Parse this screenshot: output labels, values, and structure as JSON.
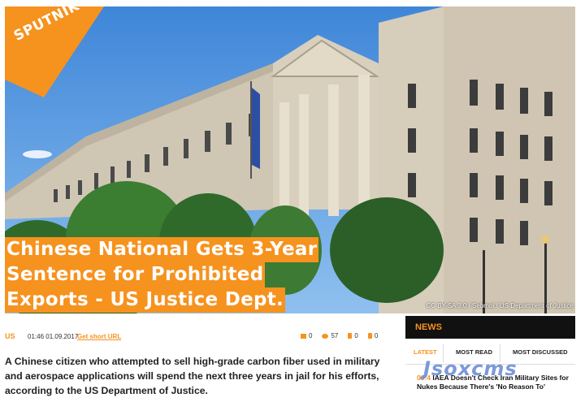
{
  "brand": {
    "name": "SPUTNIK",
    "accent": "#f6921e"
  },
  "headline": {
    "lines": [
      "Chinese National Gets 3-Year",
      "Sentence for Prohibited",
      "Exports - US Justice Dept."
    ]
  },
  "photo": {
    "credit": "CC BY-SA 3.0 / Sebmol / US Department of Justice"
  },
  "meta": {
    "category": "US",
    "timestamp": "01:46 01.09.2017",
    "short_url_label": "Get short URL",
    "comments": "0",
    "views": "57",
    "likes": "0",
    "dislikes": "0"
  },
  "article": {
    "lead": "A Chinese citizen who attempted to sell high-grade carbon fiber used in military and aerospace applications will spend the next three years in jail for his efforts, according to the US Department of Justice."
  },
  "news_widget": {
    "title": "NEWS",
    "tabs": [
      "LATEST",
      "MOST READ",
      "MOST DISCUSSED"
    ],
    "item": {
      "time": "03:4",
      "text": "IAEA Doesn't Check Iran Military Sites for Nukes Because There's 'No Reason To'"
    }
  },
  "watermark": "Jsoxcms",
  "icons": [
    "comment-icon",
    "eye-icon",
    "thumb-up-icon",
    "thumb-down-icon"
  ]
}
